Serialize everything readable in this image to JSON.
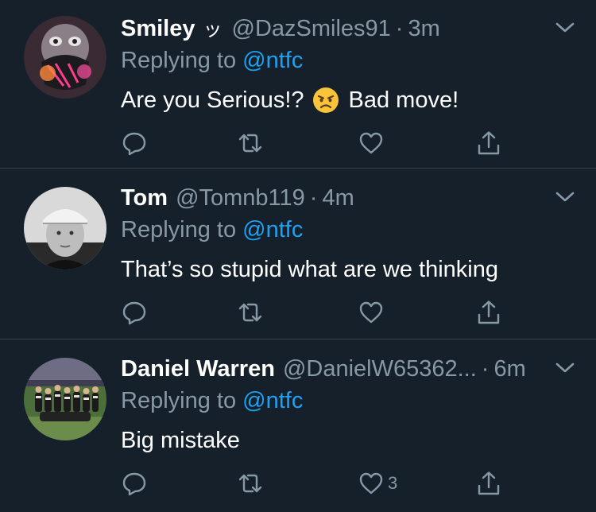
{
  "tweets": [
    {
      "name": "Smiley",
      "name_glyph": "ッ",
      "handle": "@DazSmiles91",
      "separator": "·",
      "time": "3m",
      "reply_prefix": "Replying to",
      "reply_mention": "@ntfc",
      "text_before": "Are you Serious!?",
      "emoji": "angry-face-emoji",
      "text_after": "Bad move!",
      "like_count": ""
    },
    {
      "name": "Tom",
      "handle": "@Tomnb119",
      "separator": "·",
      "time": "4m",
      "reply_prefix": "Replying to",
      "reply_mention": "@ntfc",
      "text": "That’s so stupid what are we thinking",
      "like_count": ""
    },
    {
      "name": "Daniel Warren",
      "handle": "@DanielW65362...",
      "separator": "·",
      "time": "6m",
      "reply_prefix": "Replying to",
      "reply_mention": "@ntfc",
      "text": "Big mistake",
      "like_count": "3"
    }
  ],
  "colors": {
    "background": "#15202b",
    "secondary_text": "#8899a6",
    "accent": "#1da1f2",
    "divider": "#38444d"
  },
  "icons": [
    "chevron-down-icon",
    "reply-icon",
    "retweet-icon",
    "like-icon",
    "share-icon"
  ]
}
